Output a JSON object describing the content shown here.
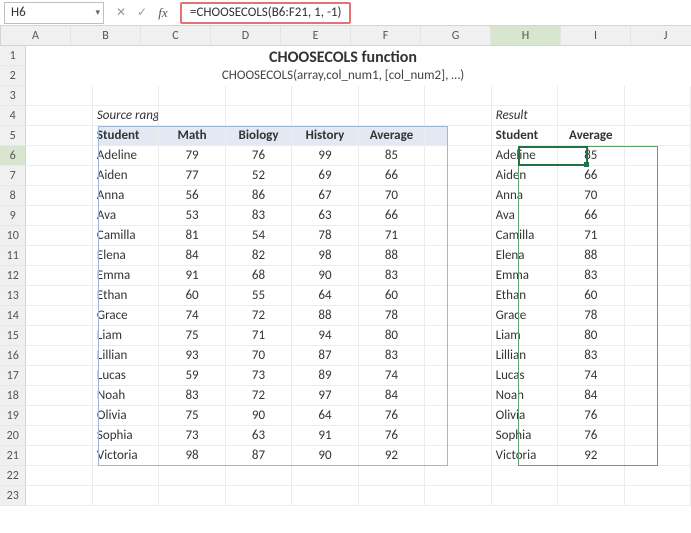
{
  "name_box": "H6",
  "formula": "=CHOOSECOLS(B6:F21, 1, -1)",
  "columns": [
    "A",
    "B",
    "C",
    "D",
    "E",
    "F",
    "G",
    "H",
    "I",
    "J"
  ],
  "active_col_index": 7,
  "active_row": 6,
  "title": "CHOOSECOLS function",
  "subtitle": "CHOOSECOLS(array,col_num1, [col_num2], …)",
  "source_label": "Source range",
  "result_label": "Result",
  "source_headers": [
    "Student",
    "Math",
    "Biology",
    "History",
    "Average"
  ],
  "result_headers": [
    "Student",
    "Average"
  ],
  "rows": [
    {
      "student": "Adeline",
      "math": "79",
      "biology": "76",
      "history": "99",
      "avg": "85"
    },
    {
      "student": "Aiden",
      "math": "77",
      "biology": "52",
      "history": "69",
      "avg": "66"
    },
    {
      "student": "Anna",
      "math": "56",
      "biology": "86",
      "history": "67",
      "avg": "70"
    },
    {
      "student": "Ava",
      "math": "53",
      "biology": "83",
      "history": "63",
      "avg": "66"
    },
    {
      "student": "Camilla",
      "math": "81",
      "biology": "54",
      "history": "78",
      "avg": "71"
    },
    {
      "student": "Elena",
      "math": "84",
      "biology": "82",
      "history": "98",
      "avg": "88"
    },
    {
      "student": "Emma",
      "math": "91",
      "biology": "68",
      "history": "90",
      "avg": "83"
    },
    {
      "student": "Ethan",
      "math": "60",
      "biology": "55",
      "history": "64",
      "avg": "60"
    },
    {
      "student": "Grace",
      "math": "74",
      "biology": "72",
      "history": "88",
      "avg": "78"
    },
    {
      "student": "Liam",
      "math": "75",
      "biology": "71",
      "history": "94",
      "avg": "80"
    },
    {
      "student": "Lillian",
      "math": "93",
      "biology": "70",
      "history": "87",
      "avg": "83"
    },
    {
      "student": "Lucas",
      "math": "59",
      "biology": "73",
      "history": "89",
      "avg": "74"
    },
    {
      "student": "Noah",
      "math": "83",
      "biology": "72",
      "history": "97",
      "avg": "84"
    },
    {
      "student": "Olivia",
      "math": "75",
      "biology": "90",
      "history": "64",
      "avg": "76"
    },
    {
      "student": "Sophia",
      "math": "73",
      "biology": "63",
      "history": "91",
      "avg": "76"
    },
    {
      "student": "Victoria",
      "math": "98",
      "biology": "87",
      "history": "90",
      "avg": "92"
    }
  ],
  "chart_data": {
    "type": "table",
    "title": "CHOOSECOLS function",
    "columns": [
      "Student",
      "Math",
      "Biology",
      "History",
      "Average"
    ],
    "data": [
      [
        "Adeline",
        79,
        76,
        99,
        85
      ],
      [
        "Aiden",
        77,
        52,
        69,
        66
      ],
      [
        "Anna",
        56,
        86,
        67,
        70
      ],
      [
        "Ava",
        53,
        83,
        63,
        66
      ],
      [
        "Camilla",
        81,
        54,
        78,
        71
      ],
      [
        "Elena",
        84,
        82,
        98,
        88
      ],
      [
        "Emma",
        91,
        68,
        90,
        83
      ],
      [
        "Ethan",
        60,
        55,
        64,
        60
      ],
      [
        "Grace",
        74,
        72,
        88,
        78
      ],
      [
        "Liam",
        75,
        71,
        94,
        80
      ],
      [
        "Lillian",
        93,
        70,
        87,
        83
      ],
      [
        "Lucas",
        59,
        73,
        89,
        74
      ],
      [
        "Noah",
        83,
        72,
        97,
        84
      ],
      [
        "Olivia",
        75,
        90,
        64,
        76
      ],
      [
        "Sophia",
        73,
        63,
        91,
        76
      ],
      [
        "Victoria",
        98,
        87,
        90,
        92
      ]
    ],
    "result_columns": [
      "Student",
      "Average"
    ]
  }
}
